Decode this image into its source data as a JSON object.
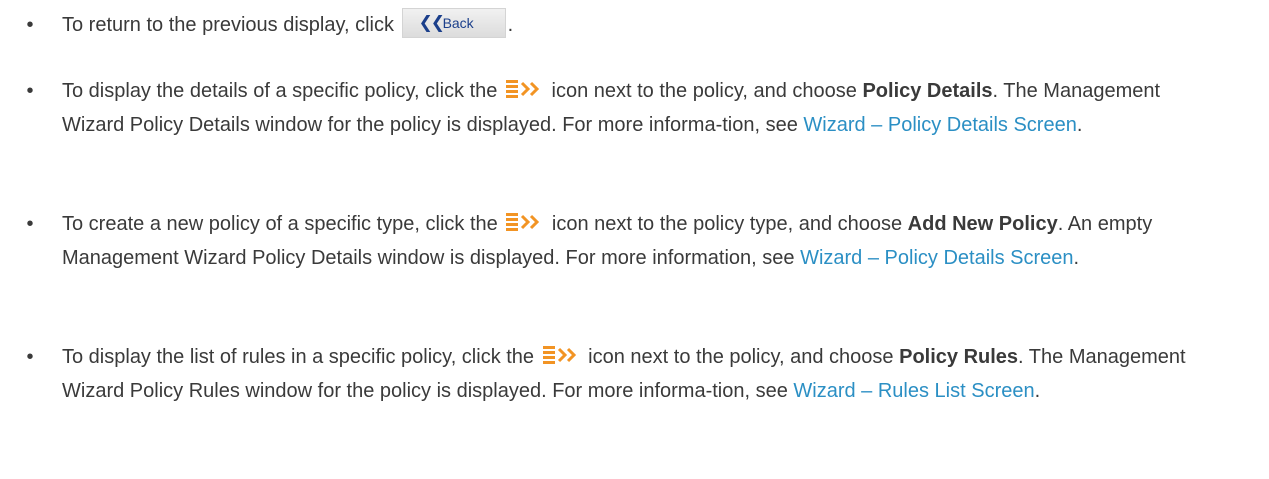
{
  "back_button": {
    "label": "Back"
  },
  "items": [
    {
      "before": "To return to the previous display, click ",
      "after": "."
    },
    {
      "p1": "To display the details of a specific policy, click the ",
      "p2": " icon next to the policy, and choose ",
      "bold": "Policy Details",
      "p3": ". The Management Wizard Policy Details window for the policy is displayed. For more informa-tion, see ",
      "link": "Wizard – Policy Details Screen",
      "p4": "."
    },
    {
      "p1": "To create a new policy of a specific type, click the ",
      "p2": " icon next to the policy type, and choose ",
      "bold": "Add New Policy",
      "p3": ". An empty Management Wizard Policy Details window is displayed. For more information, see ",
      "link": "Wizard – Policy Details Screen",
      "p4": "."
    },
    {
      "p1": "To display the list of rules in a specific policy, click the ",
      "p2": " icon next to the policy, and choose ",
      "bold": "Policy Rules",
      "p3": ". The Management Wizard Policy Rules window for the policy is displayed. For more informa-tion, see ",
      "link": "Wizard – Rules List Screen",
      "p4": "."
    }
  ],
  "icons": {
    "bullet": "•",
    "menu_icon": "action-menu-icon",
    "back_chevron": "double-chevron-left-icon"
  },
  "colors": {
    "text": "#3a3a3a",
    "link": "#2b8fc4",
    "icon_orange": "#f29424",
    "icon_blue": "#1b3f8b"
  }
}
